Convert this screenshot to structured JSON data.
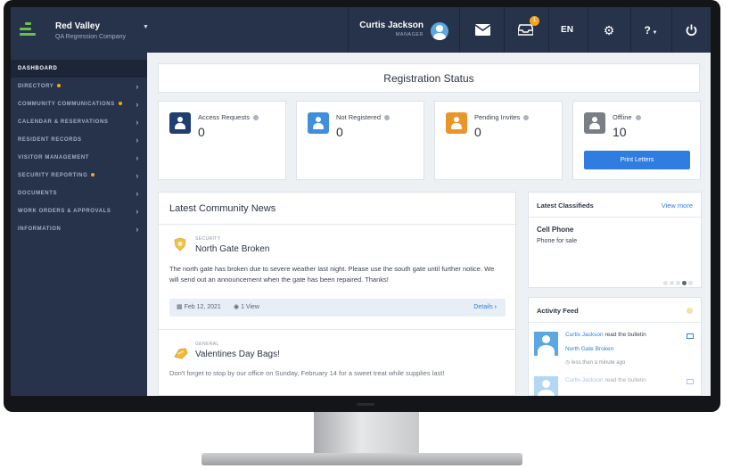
{
  "brand": {
    "name": "Red Valley",
    "subtitle": "QA Regression Company"
  },
  "user": {
    "name": "Curtis Jackson",
    "role": "MANAGER"
  },
  "topbar": {
    "notification_count": "1",
    "language": "EN",
    "help_label": "?"
  },
  "sidebar": {
    "items": [
      {
        "label": "DASHBOARD"
      },
      {
        "label": "DIRECTORY"
      },
      {
        "label": "COMMUNITY COMMUNICATIONS"
      },
      {
        "label": "CALENDAR & RESERVATIONS"
      },
      {
        "label": "RESIDENT RECORDS"
      },
      {
        "label": "VISITOR MANAGEMENT"
      },
      {
        "label": "SECURITY REPORTING"
      },
      {
        "label": "DOCUMENTS"
      },
      {
        "label": "WORK ORDERS & APPROVALS"
      },
      {
        "label": "INFORMATION"
      }
    ]
  },
  "registration": {
    "title": "Registration Status",
    "stats": [
      {
        "label": "Access Requests",
        "value": "0",
        "color": "#1f3f73"
      },
      {
        "label": "Not Registered",
        "value": "0",
        "color": "#3f8fdc"
      },
      {
        "label": "Pending Invites",
        "value": "0",
        "color": "#e8962a"
      },
      {
        "label": "Offline",
        "value": "10",
        "color": "#7a7f86"
      }
    ],
    "print_label": "Print Letters"
  },
  "news": {
    "title": "Latest Community News",
    "items": [
      {
        "category": "SECURITY",
        "headline": "North Gate Broken",
        "body": "The north gate has broken due to severe weather last night. Please use the south gate until further notice. We will send out an announcement when the gate has been repaired. Thanks!",
        "date": "Feb 12, 2021",
        "views": "1 View",
        "details": "Details"
      },
      {
        "category": "GENERAL",
        "headline": "Valentines Day Bags!",
        "body": "Don't forget to stop by our office on Sunday, February 14 for a sweet treat while supplies last!"
      }
    ]
  },
  "classifieds": {
    "title": "Latest Classifieds",
    "view_more": "View more",
    "item_title": "Cell Phone",
    "item_sub": "Phone for sale"
  },
  "activity": {
    "title": "Activity Feed",
    "entries": [
      {
        "who": "Curtis Jackson",
        "action": "read the bulletin",
        "link": "North Gate Broken",
        "time": "less than a minute ago"
      },
      {
        "who": "Curtis Jackson",
        "action": "read the bulletin"
      }
    ]
  }
}
